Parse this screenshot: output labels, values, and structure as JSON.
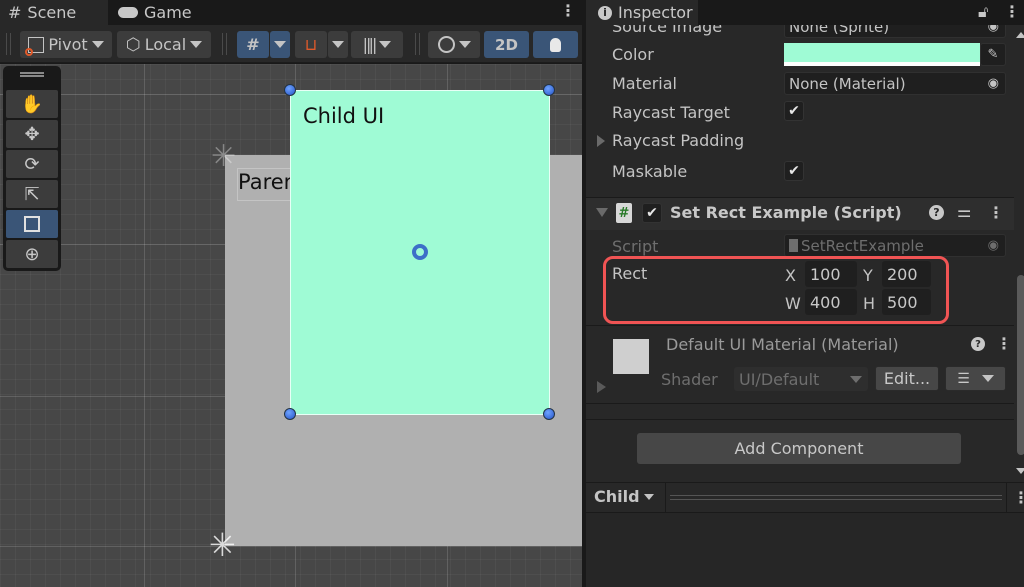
{
  "scene_panel": {
    "tabs": [
      {
        "label": "Scene",
        "icon": "grid-hash-icon",
        "active": true
      },
      {
        "label": "Game",
        "icon": "gamepad-icon",
        "active": false
      }
    ],
    "toolbar": {
      "pivot_label": "Pivot",
      "local_label": "Local",
      "mode_2d_label": "2D",
      "grid_snap_icon": "grid-snap-icon",
      "snap_increment_icon": "magnet-snap-icon",
      "increment_icon": "ruler-ticks-icon",
      "draw_mode_icon": "shading-circle-icon",
      "lighting_icon": "lightbulb-icon"
    },
    "tool_palette": [
      {
        "name": "view-tool",
        "icon": "hand-icon",
        "selected": false
      },
      {
        "name": "move-tool",
        "icon": "move-arrows-icon",
        "selected": false
      },
      {
        "name": "rotate-tool",
        "icon": "rotate-icon",
        "selected": false
      },
      {
        "name": "scale-tool",
        "icon": "scale-icon",
        "selected": false
      },
      {
        "name": "rect-tool",
        "icon": "rect-transform-icon",
        "selected": true
      },
      {
        "name": "transform-tool",
        "icon": "transform-icon",
        "selected": false
      }
    ],
    "viewport": {
      "child_label": "Child UI",
      "parent_label": "Parent UI",
      "child_color": "#9ffbd5",
      "parent_color": "#b0b0b0"
    }
  },
  "inspector": {
    "tab_label": "Inspector",
    "image_component": {
      "source_image_label": "Source Image",
      "source_image_value": "None (Sprite)",
      "color_label": "Color",
      "color_value": "#9ffbd5",
      "material_label": "Material",
      "material_value": "None (Material)",
      "raycast_target_label": "Raycast Target",
      "raycast_target_checked": true,
      "raycast_padding_label": "Raycast Padding",
      "maskable_label": "Maskable",
      "maskable_checked": true
    },
    "script_component": {
      "title": "Set Rect Example (Script)",
      "enabled": true,
      "script_label": "Script",
      "script_value": "SetRectExample",
      "rect_label": "Rect",
      "rect": {
        "x_label": "X",
        "x": "100",
        "y_label": "Y",
        "y": "200",
        "w_label": "W",
        "w": "400",
        "h_label": "H",
        "h": "500"
      },
      "highlight_color": "#f05454"
    },
    "material_component": {
      "title": "Default UI Material (Material)",
      "shader_label": "Shader",
      "shader_value": "UI/Default",
      "edit_label": "Edit..."
    },
    "add_component_label": "Add Component",
    "preview_bar": {
      "label": "Child"
    }
  }
}
